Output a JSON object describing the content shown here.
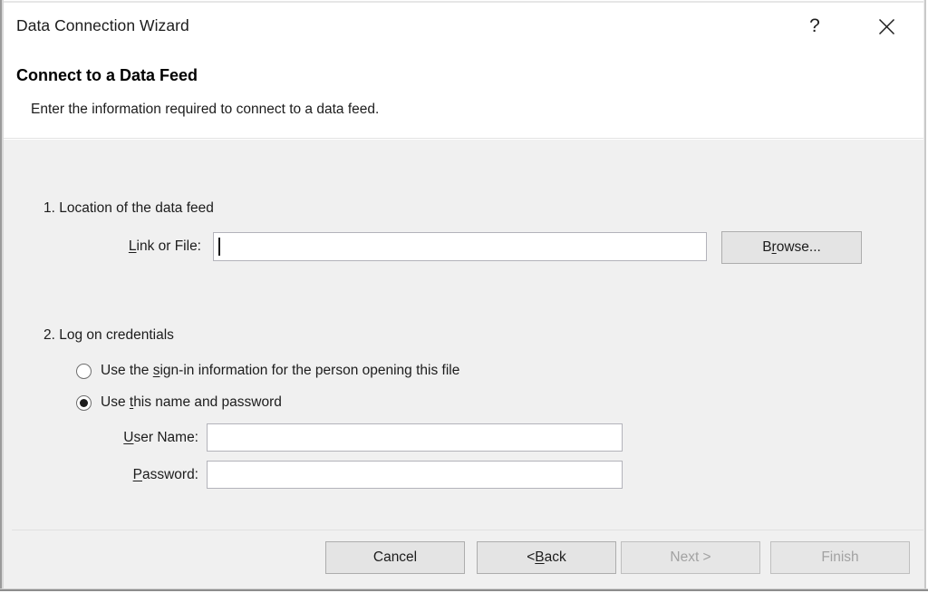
{
  "window": {
    "title": "Data Connection Wizard",
    "help_icon": "question-mark-icon",
    "help_glyph": "?",
    "close_icon": "close-icon"
  },
  "header": {
    "title": "Connect to a Data Feed",
    "subtitle": "Enter the information required to connect to a data feed."
  },
  "steps": {
    "step1": {
      "label": "1. Location of the data feed",
      "link_field": {
        "label_pre": "L",
        "label_post": "ink or File:",
        "value": "",
        "placeholder": ""
      },
      "browse_button": {
        "label_pre": "B",
        "label_accel": "r",
        "label_post": "owse..."
      }
    },
    "step2": {
      "label": "2. Log on credentials",
      "radios": [
        {
          "pre": "Use the ",
          "accel": "s",
          "post": "ign-in information for the person opening this file",
          "selected": false
        },
        {
          "pre": "Use ",
          "accel": "t",
          "post": "his name and password",
          "selected": true
        }
      ],
      "user_field": {
        "label_pre": "U",
        "label_post": "ser Name:",
        "value": "",
        "placeholder": ""
      },
      "password_field": {
        "label_pre": "P",
        "label_post": "assword:",
        "value": "",
        "placeholder": ""
      }
    }
  },
  "footer": {
    "cancel": {
      "label": "Cancel",
      "enabled": true
    },
    "back": {
      "label_pre": "< ",
      "label_accel": "B",
      "label_post": "ack",
      "enabled": true
    },
    "next": {
      "label": "Next >",
      "enabled": false
    },
    "finish": {
      "label": "Finish",
      "enabled": false
    }
  },
  "colors": {
    "dialog_background": "#ffffff",
    "body_background": "#f0f0f0",
    "button_face": "#e4e4e4",
    "button_border": "#adadad",
    "text": "#1c1c1c",
    "disabled_text": "#a2a2a2",
    "field_border": "#b3b3ba"
  }
}
